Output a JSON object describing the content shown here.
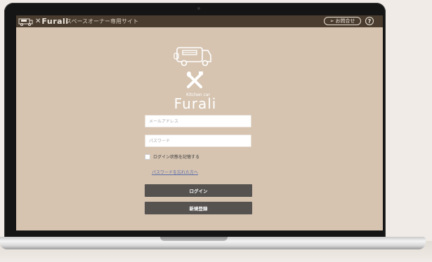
{
  "header": {
    "brand_name": "Furali",
    "site_title": "スペースオーナー専用サイト",
    "contact_label": "お問合せ"
  },
  "logo": {
    "small_text": "Kitchen car",
    "name": "Furali"
  },
  "form": {
    "email_placeholder": "メールアドレス",
    "password_placeholder": "パスワード",
    "remember_label": "ログイン状態を記憶する",
    "forgot_link": "パスワードを忘れた方へ",
    "login_button": "ログイン",
    "register_button": "新規登録"
  },
  "colors": {
    "header_bg": "#4a3d30",
    "page_bg": "#d6c4b1",
    "button_bg": "#555250",
    "logo_color": "#ffffff"
  }
}
